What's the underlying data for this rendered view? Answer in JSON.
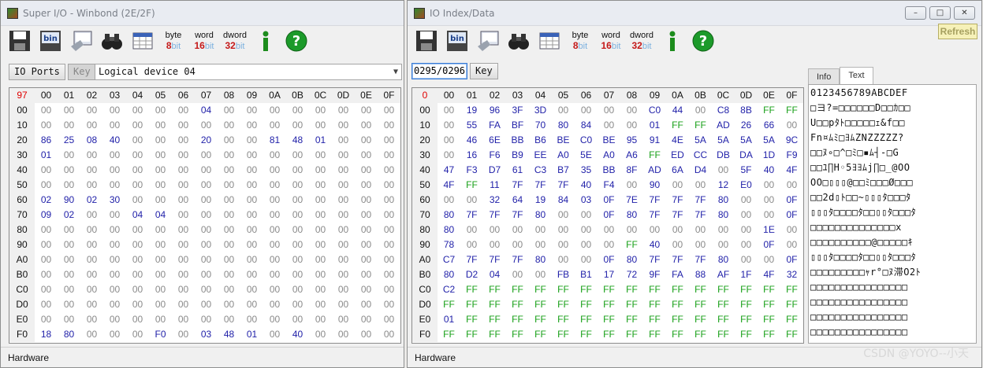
{
  "icons": {
    "save": "floppy-disk-icon",
    "bin": "bin-file-icon",
    "pc": "computer-icon",
    "search": "binoculars-icon",
    "table": "table-grid-icon",
    "info": "info-icon",
    "help": "help-icon"
  },
  "colors": {
    "zero": "#8a8a8a",
    "nonzero": "#1f1fa8",
    "ff": "#19a019",
    "header_bg": "#f0f0f0",
    "red": "#e00000",
    "refresh_bg": "#f6f1b8"
  },
  "toolbar": {
    "byte": [
      "byte",
      "8",
      "bit"
    ],
    "word": [
      "word",
      "16",
      "bit"
    ],
    "dword": [
      "dword",
      "32",
      "bit"
    ]
  },
  "win1": {
    "title": "Super I/O - Winbond (2E/2F)",
    "io_ports_label": "IO Ports",
    "key_label": "Key",
    "device_select": "Logical device 04",
    "status": "Hardware",
    "corner": "97",
    "col_headers": [
      "00",
      "01",
      "02",
      "03",
      "04",
      "05",
      "06",
      "07",
      "08",
      "09",
      "0A",
      "0B",
      "0C",
      "0D",
      "0E",
      "0F"
    ],
    "row_headers": [
      "00",
      "10",
      "20",
      "30",
      "40",
      "50",
      "60",
      "70",
      "80",
      "90",
      "A0",
      "B0",
      "C0",
      "D0",
      "E0",
      "F0"
    ],
    "rows": [
      [
        "00",
        "00",
        "00",
        "00",
        "00",
        "00",
        "00",
        "04",
        "00",
        "00",
        "00",
        "00",
        "00",
        "00",
        "00",
        "00"
      ],
      [
        "00",
        "00",
        "00",
        "00",
        "00",
        "00",
        "00",
        "00",
        "00",
        "00",
        "00",
        "00",
        "00",
        "00",
        "00",
        "00"
      ],
      [
        "86",
        "25",
        "08",
        "40",
        "00",
        "00",
        "00",
        "20",
        "00",
        "00",
        "81",
        "48",
        "01",
        "00",
        "00",
        "00"
      ],
      [
        "01",
        "00",
        "00",
        "00",
        "00",
        "00",
        "00",
        "00",
        "00",
        "00",
        "00",
        "00",
        "00",
        "00",
        "00",
        "00"
      ],
      [
        "00",
        "00",
        "00",
        "00",
        "00",
        "00",
        "00",
        "00",
        "00",
        "00",
        "00",
        "00",
        "00",
        "00",
        "00",
        "00"
      ],
      [
        "00",
        "00",
        "00",
        "00",
        "00",
        "00",
        "00",
        "00",
        "00",
        "00",
        "00",
        "00",
        "00",
        "00",
        "00",
        "00"
      ],
      [
        "02",
        "90",
        "02",
        "30",
        "00",
        "00",
        "00",
        "00",
        "00",
        "00",
        "00",
        "00",
        "00",
        "00",
        "00",
        "00"
      ],
      [
        "09",
        "02",
        "00",
        "00",
        "04",
        "04",
        "00",
        "00",
        "00",
        "00",
        "00",
        "00",
        "00",
        "00",
        "00",
        "00"
      ],
      [
        "00",
        "00",
        "00",
        "00",
        "00",
        "00",
        "00",
        "00",
        "00",
        "00",
        "00",
        "00",
        "00",
        "00",
        "00",
        "00"
      ],
      [
        "00",
        "00",
        "00",
        "00",
        "00",
        "00",
        "00",
        "00",
        "00",
        "00",
        "00",
        "00",
        "00",
        "00",
        "00",
        "00"
      ],
      [
        "00",
        "00",
        "00",
        "00",
        "00",
        "00",
        "00",
        "00",
        "00",
        "00",
        "00",
        "00",
        "00",
        "00",
        "00",
        "00"
      ],
      [
        "00",
        "00",
        "00",
        "00",
        "00",
        "00",
        "00",
        "00",
        "00",
        "00",
        "00",
        "00",
        "00",
        "00",
        "00",
        "00"
      ],
      [
        "00",
        "00",
        "00",
        "00",
        "00",
        "00",
        "00",
        "00",
        "00",
        "00",
        "00",
        "00",
        "00",
        "00",
        "00",
        "00"
      ],
      [
        "00",
        "00",
        "00",
        "00",
        "00",
        "00",
        "00",
        "00",
        "00",
        "00",
        "00",
        "00",
        "00",
        "00",
        "00",
        "00"
      ],
      [
        "00",
        "00",
        "00",
        "00",
        "00",
        "00",
        "00",
        "00",
        "00",
        "00",
        "00",
        "00",
        "00",
        "00",
        "00",
        "00"
      ],
      [
        "18",
        "80",
        "00",
        "00",
        "00",
        "F0",
        "00",
        "03",
        "48",
        "01",
        "00",
        "40",
        "00",
        "00",
        "00",
        "00"
      ]
    ]
  },
  "win2": {
    "title": "IO Index/Data",
    "port_value": "0295/0296",
    "key_label": "Key",
    "refresh_label": "Refresh",
    "status": "Hardware",
    "corner": "0",
    "tabs": [
      "Info",
      "Text"
    ],
    "col_headers": [
      "00",
      "01",
      "02",
      "03",
      "04",
      "05",
      "06",
      "07",
      "08",
      "09",
      "0A",
      "0B",
      "0C",
      "0D",
      "0E",
      "0F"
    ],
    "row_headers": [
      "00",
      "10",
      "20",
      "30",
      "40",
      "50",
      "60",
      "70",
      "80",
      "90",
      "A0",
      "B0",
      "C0",
      "D0",
      "E0",
      "F0"
    ],
    "rows": [
      [
        "00",
        "19",
        "96",
        "3F",
        "3D",
        "00",
        "00",
        "00",
        "00",
        "C0",
        "44",
        "00",
        "C8",
        "8B",
        "FF",
        "FF"
      ],
      [
        "00",
        "55",
        "FA",
        "BF",
        "70",
        "80",
        "84",
        "00",
        "00",
        "01",
        "FF",
        "FF",
        "AD",
        "26",
        "66",
        "00"
      ],
      [
        "00",
        "46",
        "6E",
        "BB",
        "B6",
        "BE",
        "C0",
        "BE",
        "95",
        "91",
        "4E",
        "5A",
        "5A",
        "5A",
        "5A",
        "9C"
      ],
      [
        "00",
        "16",
        "F6",
        "B9",
        "EE",
        "A0",
        "5E",
        "A0",
        "A6",
        "FF",
        "ED",
        "CC",
        "DB",
        "DA",
        "1D",
        "F9"
      ],
      [
        "47",
        "F3",
        "D7",
        "61",
        "C3",
        "B7",
        "35",
        "BB",
        "8F",
        "AD",
        "6A",
        "D4",
        "00",
        "5F",
        "40",
        "4F"
      ],
      [
        "4F",
        "FF",
        "11",
        "7F",
        "7F",
        "7F",
        "40",
        "F4",
        "00",
        "90",
        "00",
        "00",
        "12",
        "E0",
        "00",
        "00"
      ],
      [
        "00",
        "00",
        "32",
        "64",
        "19",
        "84",
        "03",
        "0F",
        "7E",
        "7F",
        "7F",
        "7F",
        "80",
        "00",
        "00",
        "0F"
      ],
      [
        "80",
        "7F",
        "7F",
        "7F",
        "80",
        "00",
        "00",
        "0F",
        "80",
        "7F",
        "7F",
        "7F",
        "80",
        "00",
        "00",
        "0F"
      ],
      [
        "80",
        "00",
        "00",
        "00",
        "00",
        "00",
        "00",
        "00",
        "00",
        "00",
        "00",
        "00",
        "00",
        "00",
        "1E",
        "00"
      ],
      [
        "78",
        "00",
        "00",
        "00",
        "00",
        "00",
        "00",
        "00",
        "FF",
        "40",
        "00",
        "00",
        "00",
        "00",
        "0F",
        "00"
      ],
      [
        "C7",
        "7F",
        "7F",
        "7F",
        "80",
        "00",
        "00",
        "0F",
        "80",
        "7F",
        "7F",
        "7F",
        "80",
        "00",
        "00",
        "0F"
      ],
      [
        "80",
        "D2",
        "04",
        "00",
        "00",
        "FB",
        "B1",
        "17",
        "72",
        "9F",
        "FA",
        "88",
        "AF",
        "1F",
        "4F",
        "32"
      ],
      [
        "C2",
        "FF",
        "FF",
        "FF",
        "FF",
        "FF",
        "FF",
        "FF",
        "FF",
        "FF",
        "FF",
        "FF",
        "FF",
        "FF",
        "FF",
        "FF"
      ],
      [
        "FF",
        "FF",
        "FF",
        "FF",
        "FF",
        "FF",
        "FF",
        "FF",
        "FF",
        "FF",
        "FF",
        "FF",
        "FF",
        "FF",
        "FF",
        "FF"
      ],
      [
        "01",
        "FF",
        "FF",
        "FF",
        "FF",
        "FF",
        "FF",
        "FF",
        "FF",
        "FF",
        "FF",
        "FF",
        "FF",
        "FF",
        "FF",
        "FF"
      ],
      [
        "FF",
        "FF",
        "FF",
        "FF",
        "FF",
        "FF",
        "FF",
        "FF",
        "FF",
        "FF",
        "FF",
        "FF",
        "FF",
        "FF",
        "FF",
        "FF"
      ]
    ],
    "text_rows": [
      "0123456789ABCDEF",
      "□ヨ?=□□□□□□D□□ｶ□□",
      "U□□pﾀﾄ□□□□□ｪ&f□□",
      "Fn¤ﾑﾐ□ﾖﾑZNZZZZZ?",
      "□□ﾇ∘□^□ﾐ□▪ﾑ┤-□G",
      "□□ﾕ∏H◦5ﾖﾖﾑj∏□_@OO",
      "OO□▯▯▯@□□ﾐ□□□Ø□□□",
      "□□2d▯ﾄ□□~▯▯▯ﾀ□□□ﾀ",
      "▯▯▯ﾀ□□□□ﾀ□□▯▯ﾀ□□□ﾀ",
      "□□□□□□□□□□□□□□x",
      "□□□□□□□□□□@□□□□□ｷ",
      "▯▯▯ﾀ□□□□ﾀ□□▯▯ﾀ□□□ﾀ",
      "□□□□□□□□□ｬr°□ﾇ滞O2ﾄ",
      "□□□□□□□□□□□□□□□□",
      "□□□□□□□□□□□□□□□□",
      "□□□□□□□□□□□□□□□□",
      "□□□□□□□□□□□□□□□□"
    ]
  },
  "watermark": "CSDN @YOYO--小天"
}
